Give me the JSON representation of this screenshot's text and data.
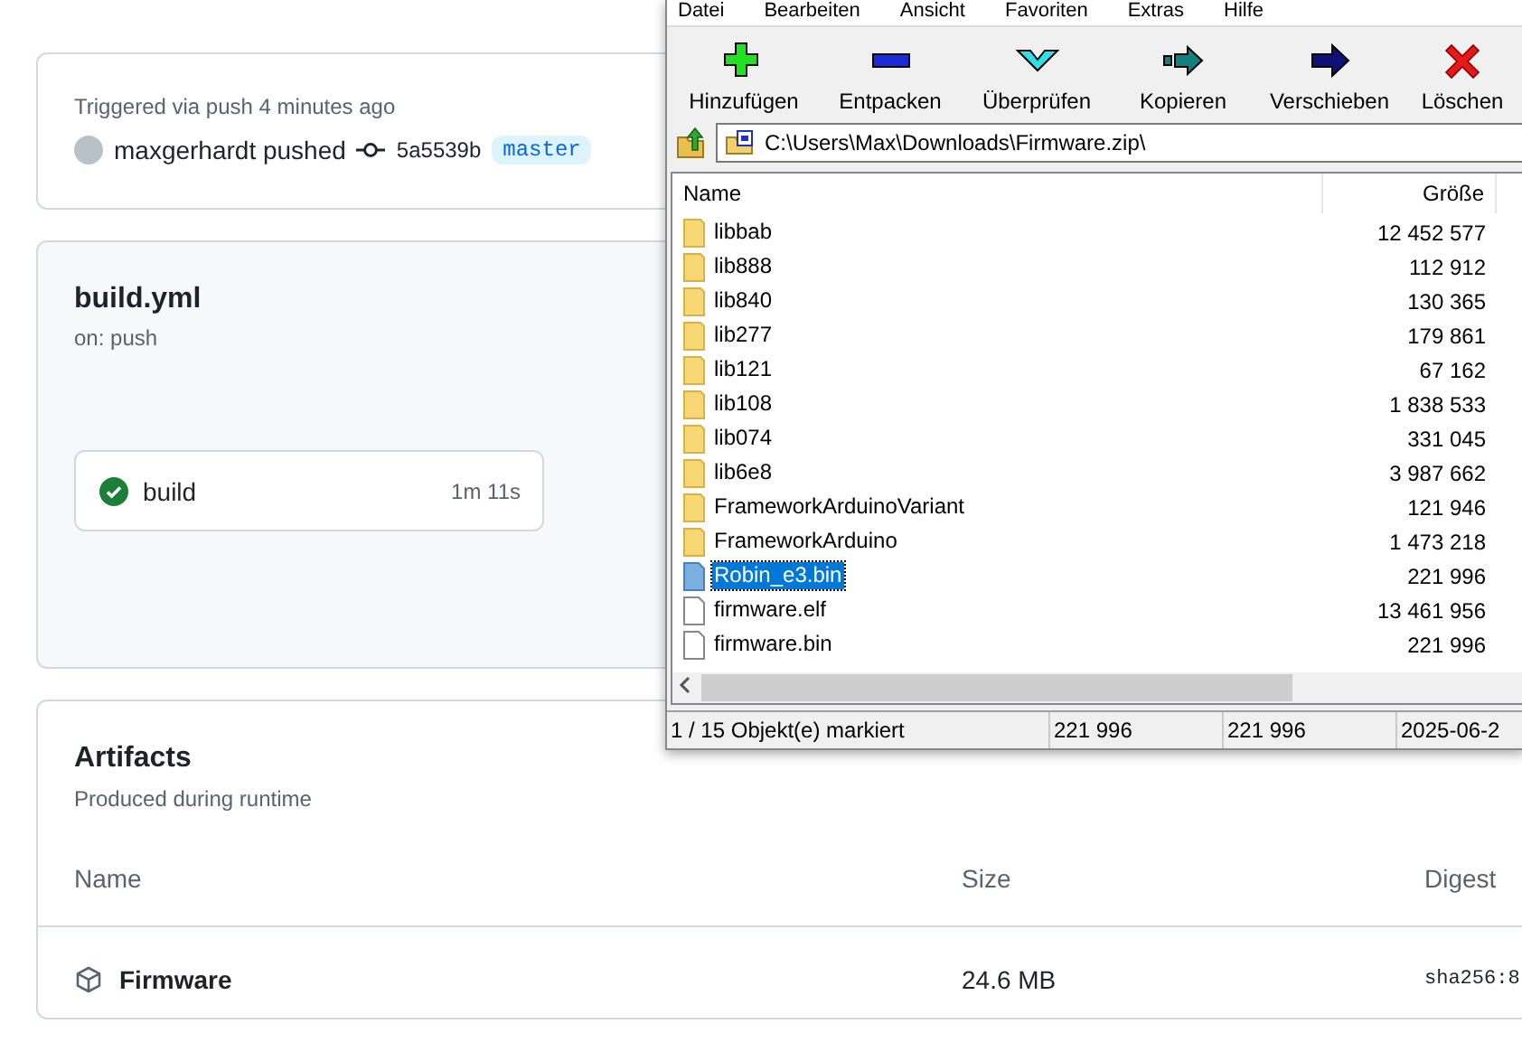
{
  "run": {
    "trigger": "Triggered via push 4 minutes ago",
    "actor": "maxgerhardt pushed",
    "commit": "5a5539b",
    "branch": "master"
  },
  "workflow": {
    "title": "build.yml",
    "subtitle": "on: push",
    "jobs": [
      {
        "name": "build",
        "passed": true,
        "duration": "1m 11s"
      }
    ]
  },
  "artifacts": {
    "title": "Artifacts",
    "subtitle": "Produced during runtime",
    "columns": [
      "Name",
      "Size",
      "Digest"
    ],
    "rows": [
      {
        "name": "Firmware",
        "size": "24.6 MB",
        "digest": "sha256:8"
      }
    ]
  },
  "archive_window": {
    "menu": [
      "Datei",
      "Bearbeiten",
      "Ansicht",
      "Favoriten",
      "Extras",
      "Hilfe"
    ],
    "toolbar": [
      {
        "label": "Hinzufügen",
        "kind": "add"
      },
      {
        "label": "Entpacken",
        "kind": "extract"
      },
      {
        "label": "Überprüfen",
        "kind": "test"
      },
      {
        "label": "Kopieren",
        "kind": "copy"
      },
      {
        "label": "Verschieben",
        "kind": "move"
      },
      {
        "label": "Löschen",
        "kind": "delete"
      }
    ],
    "path": "C:\\Users\\Max\\Downloads\\Firmware.zip\\",
    "columns": [
      "Name",
      "Größe"
    ],
    "files": [
      {
        "name": "libbab",
        "size": "12 452 577",
        "kind": "folder",
        "selected": false
      },
      {
        "name": "lib888",
        "size": "112 912",
        "kind": "folder",
        "selected": false
      },
      {
        "name": "lib840",
        "size": "130 365",
        "kind": "folder",
        "selected": false
      },
      {
        "name": "lib277",
        "size": "179 861",
        "kind": "folder",
        "selected": false
      },
      {
        "name": "lib121",
        "size": "67 162",
        "kind": "folder",
        "selected": false
      },
      {
        "name": "lib108",
        "size": "1 838 533",
        "kind": "folder",
        "selected": false
      },
      {
        "name": "lib074",
        "size": "331 045",
        "kind": "folder",
        "selected": false
      },
      {
        "name": "lib6e8",
        "size": "3 987 662",
        "kind": "folder",
        "selected": false
      },
      {
        "name": "FrameworkArduinoVariant",
        "size": "121 946",
        "kind": "folder",
        "selected": false
      },
      {
        "name": "FrameworkArduino",
        "size": "1 473 218",
        "kind": "folder",
        "selected": false
      },
      {
        "name": "Robin_e3.bin",
        "size": "221 996",
        "kind": "file",
        "selected": true
      },
      {
        "name": "firmware.elf",
        "size": "13 461 956",
        "kind": "file",
        "selected": false
      },
      {
        "name": "firmware.bin",
        "size": "221 996",
        "kind": "file",
        "selected": false
      }
    ],
    "status": [
      "1 / 15 Objekt(e) markiert",
      "221 996",
      "221 996",
      "2025-06-2"
    ]
  }
}
